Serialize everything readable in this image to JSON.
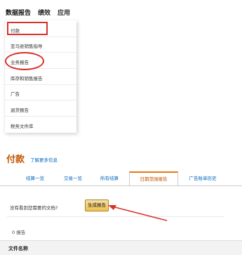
{
  "nav": {
    "items": [
      {
        "label": "数据报告"
      },
      {
        "label": "绩效"
      },
      {
        "label": "应用"
      }
    ]
  },
  "dropdown": {
    "items": [
      {
        "label": "付款"
      },
      {
        "label": "亚马逊销售指导"
      },
      {
        "label": "业务报告"
      },
      {
        "label": "库存和销售报告"
      },
      {
        "label": "广告"
      },
      {
        "label": "退货报告"
      },
      {
        "label": "税务文件库"
      }
    ]
  },
  "page": {
    "title": "付款",
    "learn_more": "了解更多信息"
  },
  "tabs": [
    {
      "label": "结算一览"
    },
    {
      "label": "交易一览"
    },
    {
      "label": "所有结算"
    },
    {
      "label": "日期范围报告"
    },
    {
      "label": "广告账单历史"
    }
  ],
  "generate": {
    "prompt": "没有看到您需要的文档?",
    "button_label": "生成报告"
  },
  "reports": {
    "count_label": "0 报告"
  },
  "table": {
    "columns": [
      "文件名称"
    ]
  },
  "colors": {
    "accent_orange": "#c45500",
    "tab_highlight": "#e47911",
    "link_blue": "#0066c0",
    "annotation_red": "#d8312b",
    "button_yellow": "#f0c14b"
  }
}
